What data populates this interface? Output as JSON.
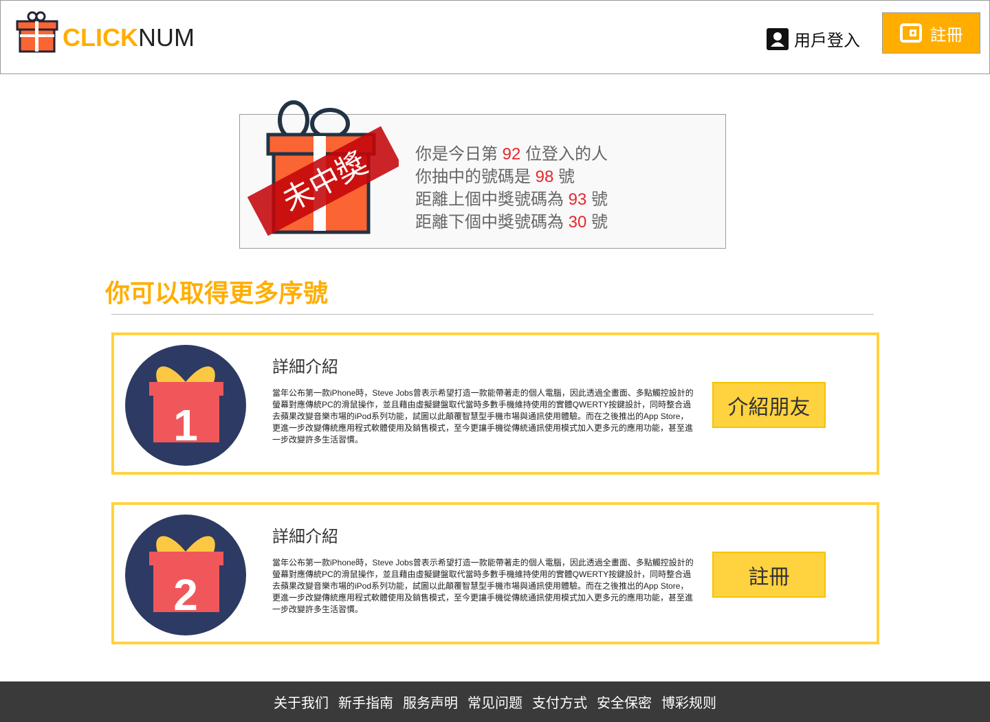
{
  "header": {
    "logo_a": "CLICK",
    "logo_b": "NUM",
    "login": "用戶登入",
    "register": "註冊"
  },
  "result": {
    "stamp": "未中獎",
    "lines": [
      {
        "pre": "你是今日第 ",
        "num": "92",
        "post": " 位登入的人"
      },
      {
        "pre": "你抽中的號碼是 ",
        "num": "98",
        "post": " 號"
      },
      {
        "pre": "距離上個中獎號碼為 ",
        "num": "93",
        "post": " 號"
      },
      {
        "pre": "距離下個中獎號碼為 ",
        "num": "30",
        "post": " 號"
      }
    ]
  },
  "more_title": "你可以取得更多序號",
  "cards": [
    {
      "number": "1",
      "title": "詳細介紹",
      "body": "當年公布第一款iPhone時，Steve Jobs曾表示希望打造一款能帶著走的個人電腦，因此透過全畫面、多點觸控設計的螢幕對應傳統PC的滑鼠操作，並且藉由虛擬鍵盤取代當時多數手機維持使用的實體QWERTY按鍵設計，同時整合過去蘋果改變音樂市場的iPod系列功能，試圖以此顛覆智慧型手機市場與通訊使用體驗。而在之後推出的App Store，更進一步改變傳統應用程式軟體使用及銷售模式，至今更讓手機從傳統通訊使用模式加入更多元的應用功能，甚至進一步改變許多生活習慣。",
      "button": "介紹朋友"
    },
    {
      "number": "2",
      "title": "詳細介紹",
      "body": "當年公布第一款iPhone時，Steve Jobs曾表示希望打造一款能帶著走的個人電腦，因此透過全畫面、多點觸控設計的螢幕對應傳統PC的滑鼠操作，並且藉由虛擬鍵盤取代當時多數手機維持使用的實體QWERTY按鍵設計，同時整合過去蘋果改變音樂市場的iPod系列功能，試圖以此顛覆智慧型手機市場與通訊使用體驗。而在之後推出的App Store，更進一步改變傳統應用程式軟體使用及銷售模式，至今更讓手機從傳統通訊使用模式加入更多元的應用功能，甚至進一步改變許多生活習慣。",
      "button": "註冊"
    }
  ],
  "footer": [
    "关于我们",
    "新手指南",
    "服务声明",
    "常见问题",
    "支付方式",
    "安全保密",
    "博彩规则"
  ]
}
